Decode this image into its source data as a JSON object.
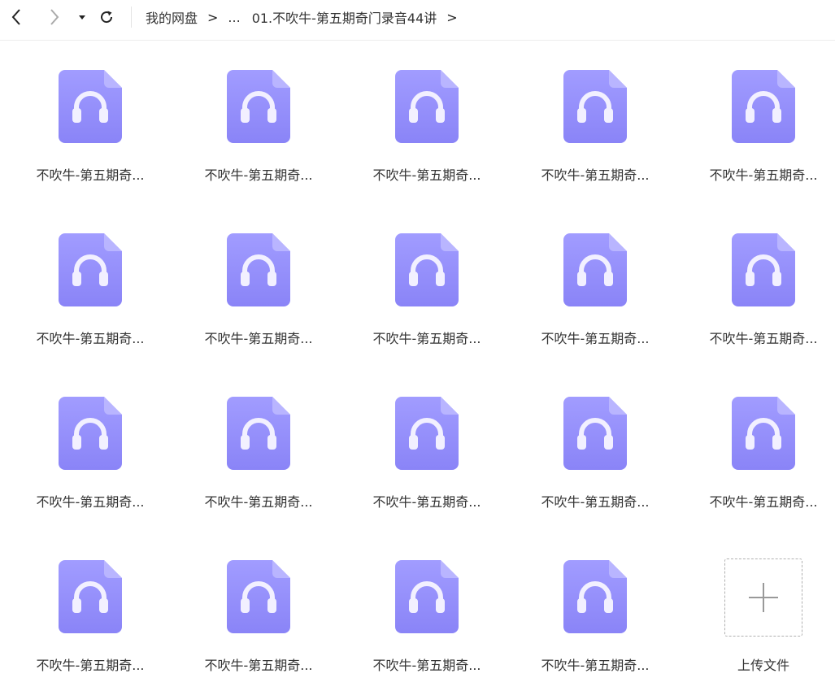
{
  "toolbar": {
    "back_icon": "chevron-left-icon",
    "forward_icon": "chevron-right-icon",
    "history_icon": "caret-down-icon",
    "refresh_icon": "refresh-icon"
  },
  "breadcrumb": {
    "root": "我的网盘",
    "ellipsis": "...",
    "current": "01.不吹牛-第五期奇门录音44讲",
    "separator": ">"
  },
  "files": [
    {
      "name": "不吹牛-第五期奇..."
    },
    {
      "name": "不吹牛-第五期奇..."
    },
    {
      "name": "不吹牛-第五期奇..."
    },
    {
      "name": "不吹牛-第五期奇..."
    },
    {
      "name": "不吹牛-第五期奇..."
    },
    {
      "name": "不吹牛-第五期奇..."
    },
    {
      "name": "不吹牛-第五期奇..."
    },
    {
      "name": "不吹牛-第五期奇..."
    },
    {
      "name": "不吹牛-第五期奇..."
    },
    {
      "name": "不吹牛-第五期奇..."
    },
    {
      "name": "不吹牛-第五期奇..."
    },
    {
      "name": "不吹牛-第五期奇..."
    },
    {
      "name": "不吹牛-第五期奇..."
    },
    {
      "name": "不吹牛-第五期奇..."
    },
    {
      "name": "不吹牛-第五期奇..."
    },
    {
      "name": "不吹牛-第五期奇..."
    },
    {
      "name": "不吹牛-第五期奇..."
    },
    {
      "name": "不吹牛-第五期奇..."
    },
    {
      "name": "不吹牛-第五期奇..."
    }
  ],
  "file_icon": "audio-file-icon",
  "upload": {
    "label": "上传文件",
    "icon": "plus-icon"
  },
  "colors": {
    "file_icon_top": "#a19cff",
    "file_icon_bottom": "#8a84f7",
    "headphone": "#f2f0ff",
    "nav_active": "#222222",
    "nav_disabled": "#aaaaaa"
  }
}
